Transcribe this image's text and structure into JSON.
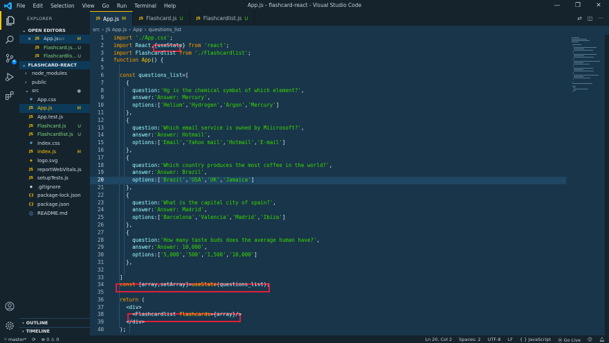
{
  "menu": [
    "File",
    "Edit",
    "Selection",
    "View",
    "Go",
    "Run",
    "Terminal",
    "Help"
  ],
  "window_title": "App.js - flashcard-react - Visual Studio Code",
  "activity_badge": "4",
  "explorer": {
    "title": "EXPLORER",
    "open_editors_label": "OPEN EDITORS",
    "open_editors": [
      {
        "icon": "JS",
        "name": "App.js",
        "path": "src",
        "status": "M"
      },
      {
        "icon": "JS",
        "name": "Flashcard.js...",
        "status": "U"
      },
      {
        "icon": "JS",
        "name": "Flashcardlis...",
        "status": "U"
      }
    ],
    "project_label": "FLASHCARD-REACT",
    "tree": [
      {
        "name": "node_modules",
        "kind": "folder",
        "status": ""
      },
      {
        "name": "public",
        "kind": "folder",
        "status": ""
      },
      {
        "name": "src",
        "kind": "folder-open",
        "status": "●"
      },
      {
        "name": "App.css",
        "icon": "#",
        "status": ""
      },
      {
        "name": "App.js",
        "icon": "JS",
        "status": "M"
      },
      {
        "name": "App.test.js",
        "icon": "JS",
        "status": ""
      },
      {
        "name": "Flashcard.js",
        "icon": "JS",
        "status": "U"
      },
      {
        "name": "Flashcardlist.js",
        "icon": "JS",
        "status": "U"
      },
      {
        "name": "index.css",
        "icon": "#",
        "status": ""
      },
      {
        "name": "index.js",
        "icon": "JS",
        "status": "M"
      },
      {
        "name": "logo.svg",
        "icon": "◈",
        "status": ""
      },
      {
        "name": "reportWebVitals.js",
        "icon": "JS",
        "status": ""
      },
      {
        "name": "setupTests.js",
        "icon": "JS",
        "status": ""
      },
      {
        "name": ".gitignore",
        "icon": "◆",
        "status": ""
      },
      {
        "name": "package-lock.json",
        "icon": "{}",
        "status": ""
      },
      {
        "name": "package.json",
        "icon": "{}",
        "status": ""
      },
      {
        "name": "README.md",
        "icon": "ⓘ",
        "status": ""
      }
    ],
    "outline_label": "OUTLINE",
    "timeline_label": "TIMELINE"
  },
  "tabs": [
    {
      "icon": "JS",
      "label": "App.js",
      "status": "M",
      "active": true
    },
    {
      "icon": "JS",
      "label": "Flashcard.js",
      "status": "U",
      "active": false
    },
    {
      "icon": "JS",
      "label": "Flashcardlist.js",
      "status": "U",
      "active": false
    }
  ],
  "breadcrumb": [
    "src",
    "JS App.js",
    "App",
    "questions_list"
  ],
  "code_lines": [
    "import './App.css';",
    "import React,{useState} from 'react';",
    "import Flashcardlist from './Flashcardlist';",
    "function App() {",
    "",
    "  const questions_list=[",
    "    {",
    "      question:'Hg is the chemical symbol of which element?',",
    "      answer:'Answer: Mercury',",
    "      options:['Helium','Hydrogen','Argon','Mercury']",
    "    },",
    "    {",
    "      question:'Which email service is owned by Miicrosoft?',",
    "      answer:'Answer: Hotmail',",
    "      options:['Email','Yahoo mail','Hotmail','E-mail']",
    "    },",
    "    {",
    "      question:'Which country produces the most coffee in the world?',",
    "      answer:'Answer: Brazil',",
    "      options:['Brazil','USA','UK','Jamaica']",
    "    },",
    "    {",
    "      question:'What is the capital city of spain?',",
    "      answer:'Answer: Madrid',",
    "      options:['Barcelona','Valencia','Madrid','Ibiza']",
    "    },",
    "    {",
    "      question:'How many taste buds does the average human have?',",
    "      answer:'Answer: 10,000',",
    "      options:['5,000','500','1,500','10,000']",
    "    },",
    "",
    "  ]",
    "  const [array,setArray]=useState(questions_list);",
    "",
    "  return (",
    "    <div>",
    "      <Flashcardlist flashcards={array}/>",
    "    </div>",
    "  );"
  ],
  "current_line": 20,
  "status": {
    "branch": "master*",
    "problems": "⊗ 0 ⚠ 0",
    "position": "Ln 20, Col 2",
    "spaces": "Spaces: 2",
    "encoding": "UTF-8",
    "eol": "LF",
    "language": "{ } JavaScript",
    "go_live": "Go Live"
  },
  "colors": {
    "editor_bg": "#193549",
    "sidebar_bg": "#15232d",
    "accent": "#ffc600",
    "highlight_box": "#e0203a"
  }
}
